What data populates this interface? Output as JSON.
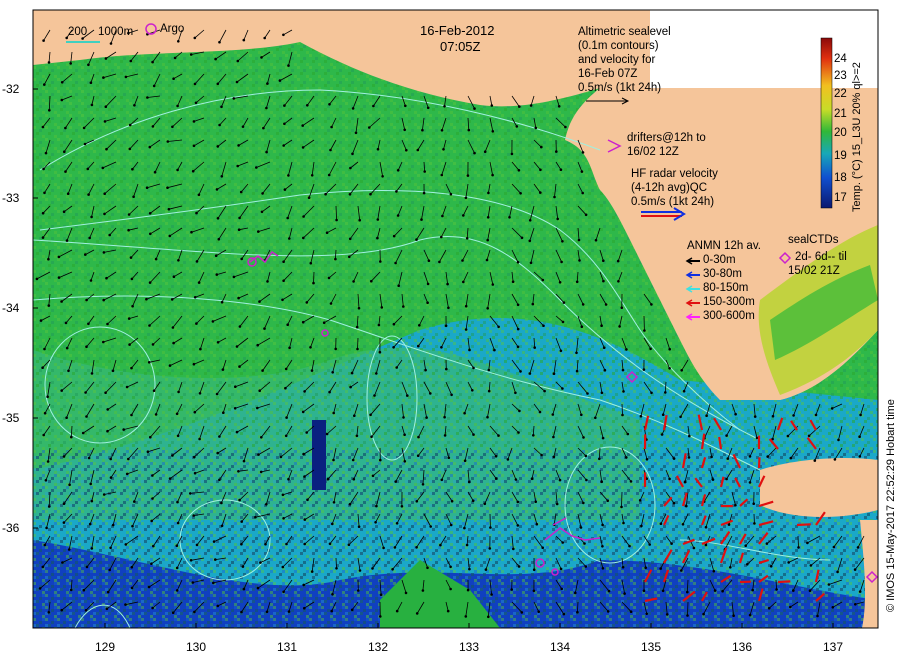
{
  "header": {
    "date": "16-Feb-2012",
    "time": "07:05Z"
  },
  "scale_bar": {
    "label_200": "200",
    "label_1000": "1000m",
    "argo_label": "Argo"
  },
  "altimetry_note": {
    "line1": "Altimetric sealevel",
    "line2": "(0.1m contours)",
    "line3": "and velocity for",
    "line4": "16-Feb 07Z",
    "line5": "0.5m/s (1kt 24h)"
  },
  "drifters_note": {
    "line1": "drifters@12h to",
    "line2": "16/02 12Z"
  },
  "hf_radar_note": {
    "line1": "HF radar velocity",
    "line2": "(4-12h avg)QC",
    "line3": "0.5m/s (1kt 24h)"
  },
  "anmn_legend": {
    "title": "ANMN 12h av.",
    "items": [
      {
        "label": "0-30m",
        "color": "#000000"
      },
      {
        "label": "30-80m",
        "color": "#1030e0"
      },
      {
        "label": "80-150m",
        "color": "#40e0e0"
      },
      {
        "label": "150-300m",
        "color": "#e01010"
      },
      {
        "label": "300-600m",
        "color": "#ff20ff"
      }
    ]
  },
  "seal_note": {
    "line1": "sealCTDs",
    "line2": "2d- 6d-- til",
    "line3": "15/02 21Z"
  },
  "colorbar": {
    "ticks": [
      "24",
      "23",
      "22",
      "21",
      "20",
      "19",
      "18",
      "17"
    ],
    "label": "Temp. (°C) 15_L3U 20% ql>=2"
  },
  "y_axis": {
    "ticks": [
      "-32",
      "-33",
      "-34",
      "-35",
      "-36"
    ]
  },
  "x_axis": {
    "ticks": [
      "129",
      "130",
      "131",
      "132",
      "133",
      "134",
      "135",
      "136",
      "137"
    ]
  },
  "credit": "© IMOS 15-May-2017 22:52:29 Hobart time",
  "colors": {
    "land": "#f5c59a",
    "sst_warm": "#2eb82e",
    "sst_cool": "#1aa8c8",
    "sst_cold": "#1040c0",
    "contour": "#a0f0e0",
    "hf_radar_red": "#e01010",
    "hf_radar_blue": "#1030e0",
    "argo_magenta": "#cc22cc"
  }
}
